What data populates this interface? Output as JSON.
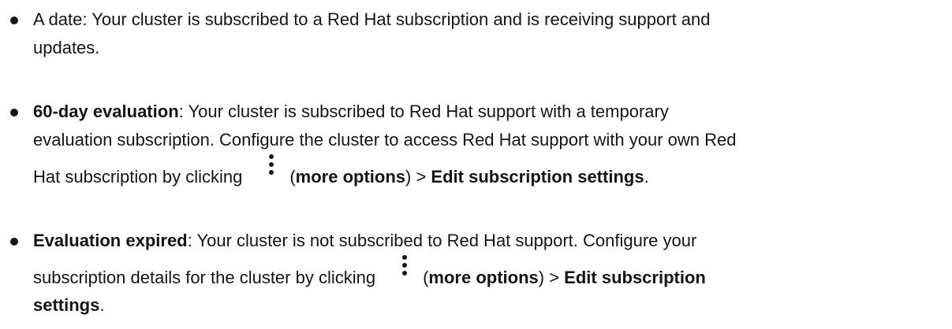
{
  "items": [
    {
      "lines": [
        [
          "A date: Your cluster is subscribed to a Red Hat subscription and is receiving support and"
        ],
        [
          "updates."
        ]
      ]
    },
    {
      "term": "60-day evaluation",
      "line1_rest": ": Your cluster is subscribed to Red Hat support with a temporary",
      "line2": "evaluation subscription. Configure the cluster to access Red Hat support with your own Red",
      "line3_pre": "Hat subscription by clicking",
      "more_options": "more options",
      "separator": " > ",
      "action": "Edit subscription settings",
      "end": "."
    },
    {
      "term": "Evaluation expired",
      "line1_rest": ": Your cluster is not subscribed to Red Hat support. Configure your",
      "line2_pre": "subscription details for the cluster by clicking",
      "more_options": "more options",
      "separator": " > ",
      "action_part1": "Edit subscription",
      "action_part2": "settings",
      "end": "."
    }
  ],
  "icons": {
    "kebab": "kebab-vertical-icon"
  }
}
